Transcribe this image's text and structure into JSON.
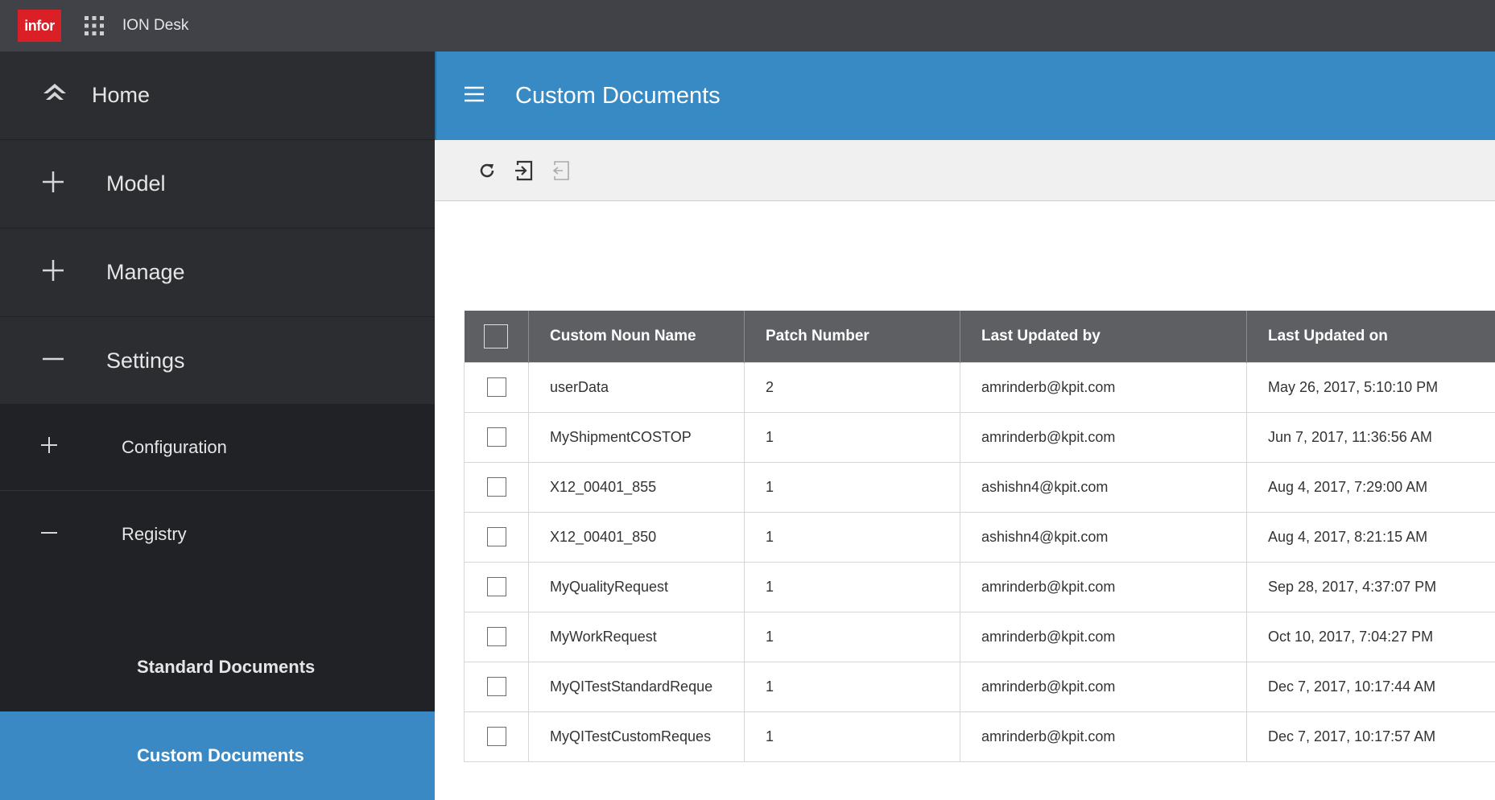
{
  "topbar": {
    "logo_text": "infor",
    "app_title": "ION Desk",
    "apps_icon": "grid-icon",
    "brand_color": "#da1f26"
  },
  "sidebar": {
    "home": {
      "label": "Home",
      "icon": "home-icon"
    },
    "model": {
      "label": "Model",
      "icon": "plus-icon"
    },
    "manage": {
      "label": "Manage",
      "icon": "plus-icon"
    },
    "settings": {
      "label": "Settings",
      "icon": "minus-icon"
    },
    "configuration": {
      "label": "Configuration",
      "icon": "plus-icon"
    },
    "registry": {
      "label": "Registry",
      "icon": "minus-icon"
    },
    "standard_documents": {
      "label": "Standard Documents"
    },
    "custom_documents": {
      "label": "Custom Documents",
      "selected": true
    }
  },
  "header": {
    "title": "Custom Documents",
    "menu_icon": "hamburger-icon",
    "accent_color": "#378ac4"
  },
  "toolbar": {
    "buttons": [
      "refresh-icon",
      "import-icon",
      "export-icon"
    ]
  },
  "table": {
    "columns": [
      "Custom Noun Name",
      "Patch Number",
      "Last Updated by",
      "Last Updated on"
    ],
    "rows": [
      {
        "name": "userData",
        "patch": "2",
        "updated_by": "amrinderb@kpit.com",
        "updated_on": "May 26, 2017, 5:10:10 PM"
      },
      {
        "name": "MyShipmentCOSTOP",
        "patch": "1",
        "updated_by": "amrinderb@kpit.com",
        "updated_on": "Jun 7, 2017, 11:36:56 AM"
      },
      {
        "name": "X12_00401_855",
        "patch": "1",
        "updated_by": "ashishn4@kpit.com",
        "updated_on": "Aug 4, 2017, 7:29:00 AM"
      },
      {
        "name": "X12_00401_850",
        "patch": "1",
        "updated_by": "ashishn4@kpit.com",
        "updated_on": "Aug 4, 2017, 8:21:15 AM"
      },
      {
        "name": "MyQualityRequest",
        "patch": "1",
        "updated_by": "amrinderb@kpit.com",
        "updated_on": "Sep 28, 2017, 4:37:07 PM"
      },
      {
        "name": "MyWorkRequest",
        "patch": "1",
        "updated_by": "amrinderb@kpit.com",
        "updated_on": "Oct 10, 2017, 7:04:27 PM"
      },
      {
        "name": "MyQITestStandardReque",
        "patch": "1",
        "updated_by": "amrinderb@kpit.com",
        "updated_on": "Dec 7, 2017, 10:17:44 AM"
      },
      {
        "name": "MyQITestCustomReques",
        "patch": "1",
        "updated_by": "amrinderb@kpit.com",
        "updated_on": "Dec 7, 2017, 10:17:57 AM"
      }
    ]
  }
}
